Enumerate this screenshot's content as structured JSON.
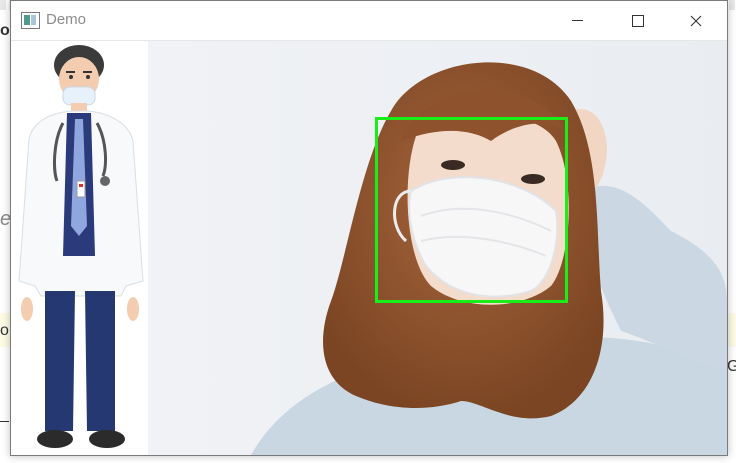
{
  "window": {
    "title": "Demo",
    "controls": [
      "minimize",
      "maximize",
      "close"
    ]
  },
  "detection": {
    "box_color": "#19ee19"
  },
  "background": {
    "fragments": [
      "b",
      "o",
      "e",
      "o",
      "G",
      "(",
      ")"
    ]
  },
  "icons": {
    "app": "app-icon",
    "minimize": "minimize-icon",
    "maximize": "maximize-icon",
    "close": "close-icon"
  }
}
